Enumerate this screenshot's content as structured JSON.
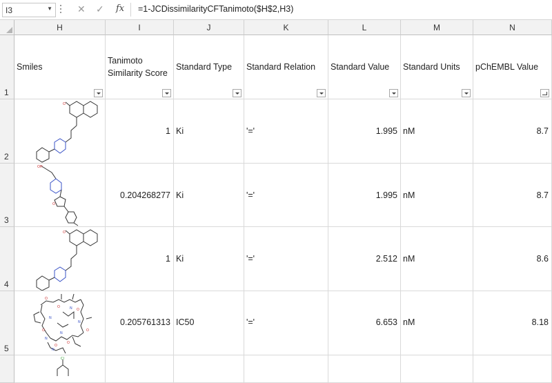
{
  "formula_bar": {
    "name_box": "I3",
    "formula": "=1-JCDissimilarityCFTanimoto($H$2,H3)",
    "cancel_icon": "cancel-x-icon",
    "enter_icon": "enter-check-icon",
    "fx_label": "fx"
  },
  "columns": [
    {
      "letter": "H",
      "header": "Smiles"
    },
    {
      "letter": "I",
      "header": "Tanimoto Similarity Score"
    },
    {
      "letter": "J",
      "header": "Standard Type"
    },
    {
      "letter": "K",
      "header": "Standard Relation"
    },
    {
      "letter": "L",
      "header": "Standard Value"
    },
    {
      "letter": "M",
      "header": "Standard Units"
    },
    {
      "letter": "N",
      "header": "pChEMBL Value"
    }
  ],
  "header_wrap": {
    "line1": "Tanimoto",
    "line2": "Similarity Score"
  },
  "rows": [
    {
      "num": "1"
    },
    {
      "num": "2",
      "score": "1",
      "type": "Ki",
      "relation": "'='",
      "value": "1.995",
      "units": "nM",
      "pchembl": "8.7"
    },
    {
      "num": "3",
      "score": "0.204268277",
      "type": "Ki",
      "relation": "'='",
      "value": "1.995",
      "units": "nM",
      "pchembl": "8.7"
    },
    {
      "num": "4",
      "score": "1",
      "type": "Ki",
      "relation": "'='",
      "value": "2.512",
      "units": "nM",
      "pchembl": "8.6"
    },
    {
      "num": "5",
      "score": "0.205761313",
      "type": "IC50",
      "relation": "'='",
      "value": "6.653",
      "units": "nM",
      "pchembl": "8.18"
    }
  ],
  "colors": {
    "selection": "#217346",
    "header_bg": "#f2f2f2",
    "grid": "#d9d9d9"
  }
}
